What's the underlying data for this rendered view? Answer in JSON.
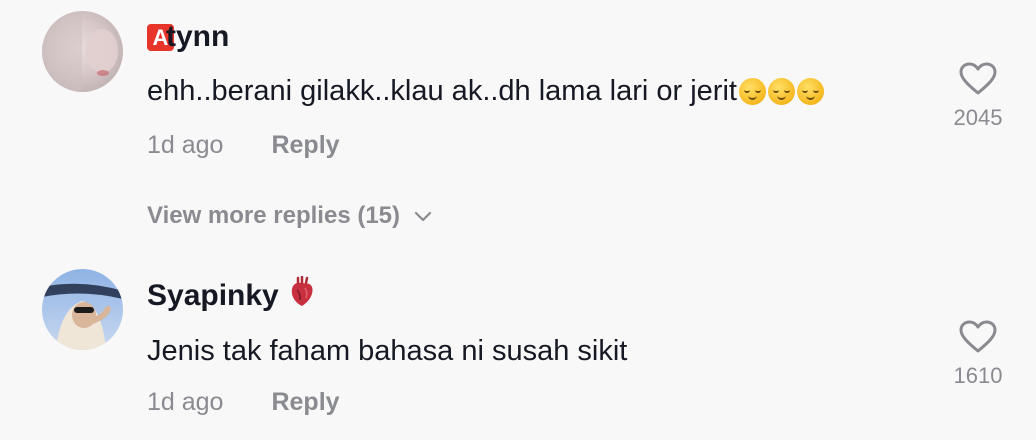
{
  "comments": [
    {
      "username": "tynn",
      "badge_letter": "A",
      "text": "ehh..berani gilakk..klau ak..dh lama lari or jerit",
      "emoji": "relieved-face-emoji x3",
      "time": "1d ago",
      "reply_label": "Reply",
      "likes": "2045",
      "view_more": "View more replies (15)"
    },
    {
      "username": "Syapinky",
      "emoji": "anatomical-heart-emoji",
      "text": "Jenis tak faham bahasa ni susah sikit",
      "time": "1d ago",
      "reply_label": "Reply",
      "likes": "1610"
    }
  ],
  "colors": {
    "background": "#f8f8f8",
    "primary_text": "#161823",
    "secondary_text": "#8a8b91",
    "badge_red": "#e8352c"
  }
}
